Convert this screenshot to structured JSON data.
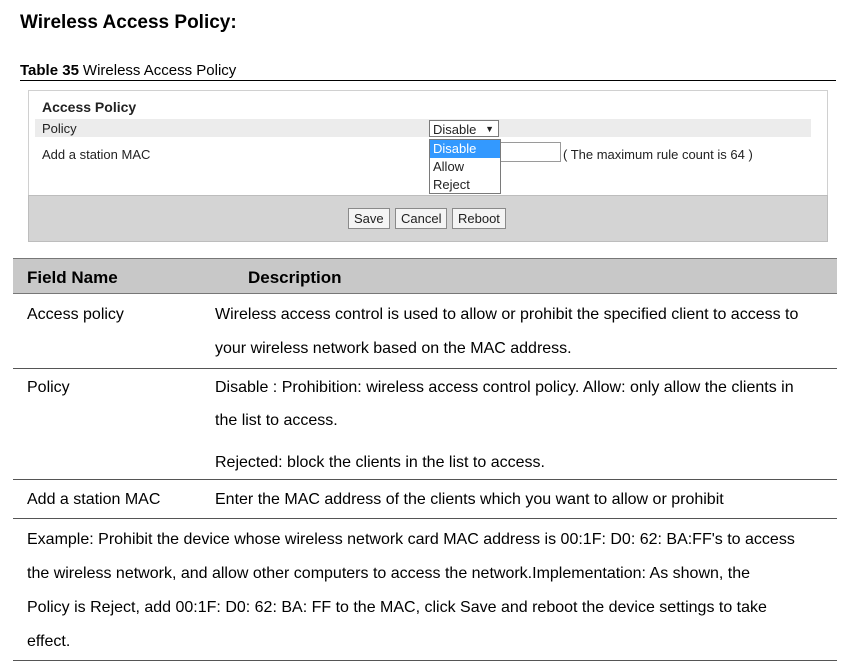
{
  "heading": "Wireless Access Policy:",
  "caption": {
    "label": "Table 35",
    "text": "Wireless Access  Policy"
  },
  "screenshot": {
    "section_title": "Access Policy",
    "policy_label": "Policy",
    "policy_value": "Disable",
    "mac_label": "Add a station MAC",
    "mac_value": "",
    "hint": "( The maximum rule count is 64 )",
    "options": [
      "Disable",
      "Allow",
      "Reject"
    ],
    "selected_option": "Disable",
    "buttons": {
      "save": "Save",
      "cancel": "Cancel",
      "reboot": "Reboot"
    }
  },
  "table": {
    "headers": [
      "Field Name",
      "Description"
    ],
    "rows": [
      {
        "field": "Access policy",
        "desc_lines": [
          "Wireless access control is used to allow or prohibit the specified client to access to",
          "your wireless network based on the MAC  address."
        ]
      },
      {
        "field": "Policy",
        "desc_lines": [
          "Disable : Prohibition: wireless access control policy. Allow: only allow the clients in",
          "the list to  access.",
          "Rejected: block the clients in the list to access."
        ]
      },
      {
        "field": "Add a station MAC",
        "desc_lines": [
          "Enter the MAC address of the clients which you want to allow or prohibit"
        ]
      }
    ],
    "example_lines": [
      "Example: Prohibit the device whose wireless network card MAC address is 00:1F: D0: 62:  BA:FF's to access",
      "the wireless network, and allow other computers to access the network.Implementation: As shown, the",
      "Policy is Reject, add 00:1F: D0: 62: BA: FF to the MAC, click Save and reboot the device settings to take",
      "effect."
    ]
  }
}
